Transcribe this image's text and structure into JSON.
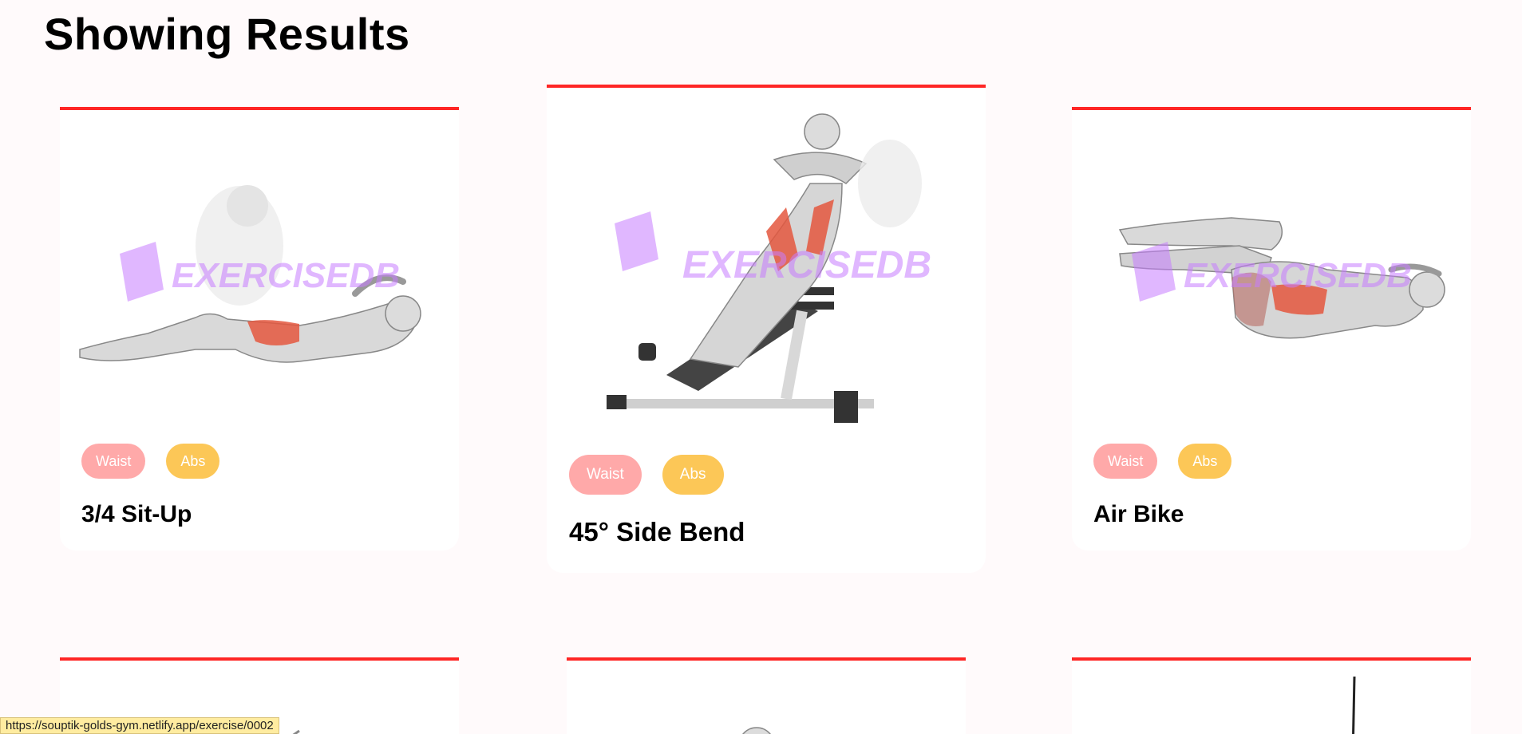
{
  "page": {
    "heading": "Showing Results"
  },
  "watermark": {
    "text": "EXERCISEDB",
    "color": "#c77dff"
  },
  "colors": {
    "accent": "#ff2625",
    "waist_tag": "#ffa9a9",
    "abs_tag": "#fcc757"
  },
  "cards": [
    {
      "name": "3/4 Sit-Up",
      "body_part": "Waist",
      "target": "Abs",
      "image": "sit-up-illustration"
    },
    {
      "name": "45° Side Bend",
      "body_part": "Waist",
      "target": "Abs",
      "image": "side-bend-illustration"
    },
    {
      "name": "Air Bike",
      "body_part": "Waist",
      "target": "Abs",
      "image": "air-bike-illustration"
    }
  ],
  "status_bar": {
    "url": "https://souptik-golds-gym.netlify.app/exercise/0002"
  }
}
